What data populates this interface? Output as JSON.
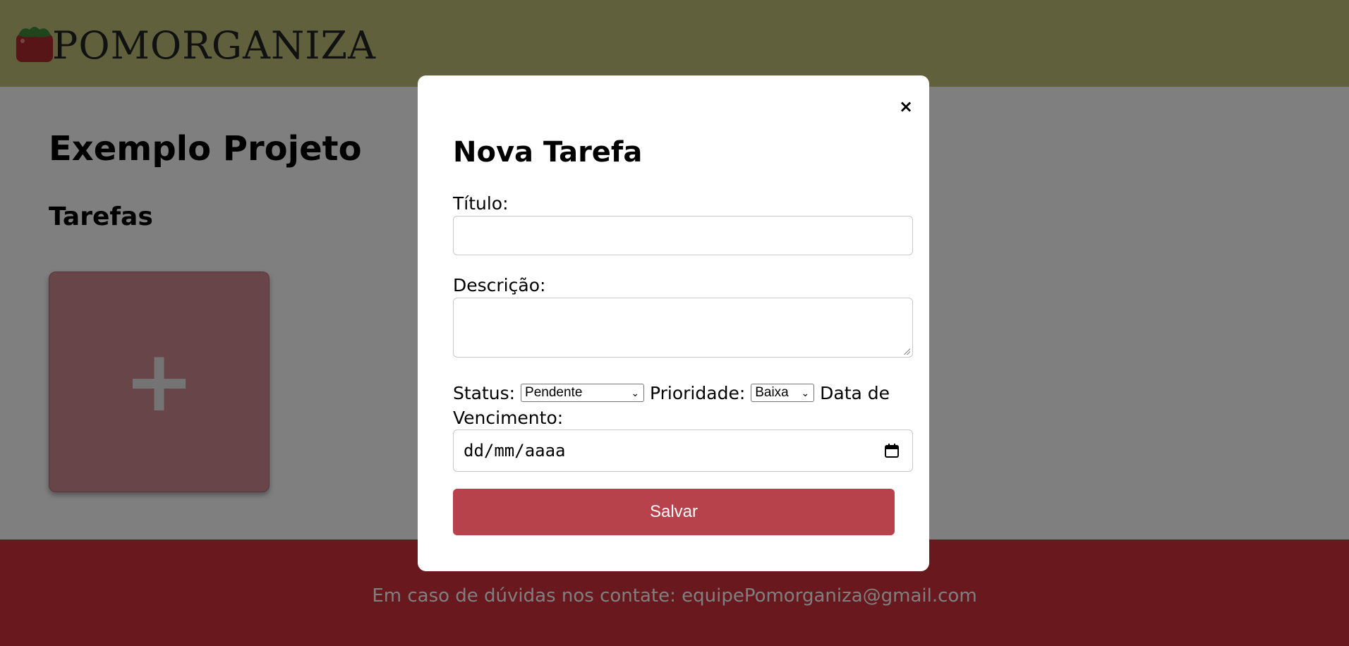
{
  "header": {
    "logo_text": "POMORGANIZA"
  },
  "main": {
    "project_title": "Exemplo Projeto",
    "section_title": "Tarefas",
    "add_card_symbol": "+"
  },
  "footer": {
    "contact_text": "Em caso de dúvidas nos contate: equipePomorganiza@gmail.com"
  },
  "modal": {
    "close_symbol": "×",
    "title": "Nova Tarefa",
    "title_label": "Título:",
    "title_value": "",
    "description_label": "Descrição:",
    "description_value": "",
    "status_label": "Status:",
    "status_value": "Pendente",
    "priority_label": "Prioridade:",
    "priority_value": "Baixa",
    "due_date_label": "Data de Vencimento:",
    "due_date_placeholder": "dd/mm/aaaa",
    "save_label": "Salvar"
  },
  "colors": {
    "header_bg": "#c0c07a",
    "footer_bg": "#d2303c",
    "card_bg": "#cf8a92",
    "save_button": "#b8424c",
    "overlay": "rgba(0,0,0,0.5)"
  },
  "icons": [
    "tomato-logo-icon",
    "close-icon",
    "plus-icon",
    "chevron-down-icon",
    "calendar-icon"
  ]
}
